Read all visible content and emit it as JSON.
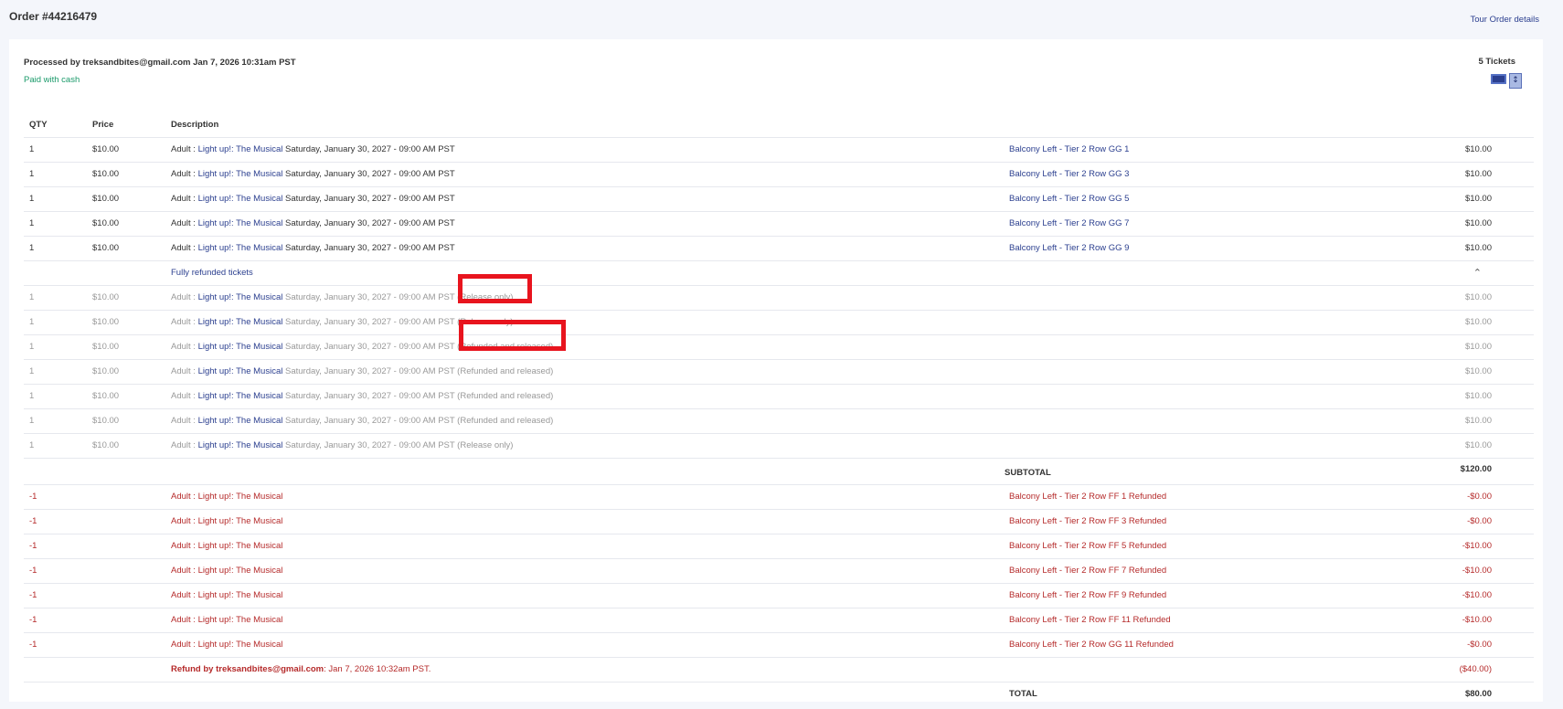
{
  "header": {
    "order_title": "Order #44216479",
    "tour_link": "Tour Order details"
  },
  "summary": {
    "processed_by": "Processed by treksandbites@gmail.com Jan 7, 2026 10:31am PST",
    "payment": "Paid with cash",
    "tickets_count": "5 Tickets",
    "icons": [
      "ticket-card-icon",
      "print-document-icon"
    ]
  },
  "table": {
    "headers": {
      "qty": "QTY",
      "price": "Price",
      "description": "Description"
    },
    "active_rows": [
      {
        "qty": "1",
        "price": "$10.00",
        "prefix": "Adult : ",
        "name": "Light up!: The Musical",
        "date": " Saturday, January 30, 2027 - 09:00 AM PST",
        "seat": "Balcony Left - Tier 2 Row GG 1",
        "amount": "$10.00"
      },
      {
        "qty": "1",
        "price": "$10.00",
        "prefix": "Adult : ",
        "name": "Light up!: The Musical",
        "date": " Saturday, January 30, 2027 - 09:00 AM PST",
        "seat": "Balcony Left - Tier 2 Row GG 3",
        "amount": "$10.00"
      },
      {
        "qty": "1",
        "price": "$10.00",
        "prefix": "Adult : ",
        "name": "Light up!: The Musical",
        "date": " Saturday, January 30, 2027 - 09:00 AM PST",
        "seat": "Balcony Left - Tier 2 Row GG 5",
        "amount": "$10.00"
      },
      {
        "qty": "1",
        "price": "$10.00",
        "prefix": "Adult : ",
        "name": "Light up!: The Musical",
        "date": " Saturday, January 30, 2027 - 09:00 AM PST",
        "seat": "Balcony Left - Tier 2 Row GG 7",
        "amount": "$10.00"
      },
      {
        "qty": "1",
        "price": "$10.00",
        "prefix": "Adult : ",
        "name": "Light up!: The Musical",
        "date": " Saturday, January 30, 2027 - 09:00 AM PST",
        "seat": "Balcony Left - Tier 2 Row GG 9",
        "amount": "$10.00"
      }
    ],
    "refunded_toggle": {
      "label": "Fully refunded tickets",
      "icon": "chevron-up-icon"
    },
    "refunded_rows": [
      {
        "qty": "1",
        "price": "$10.00",
        "prefix": "Adult : ",
        "name": "Light up!: The Musical",
        "date": " Saturday, January 30, 2027 - 09:00 AM PST ",
        "status": "(Release only)",
        "amount": "$10.00"
      },
      {
        "qty": "1",
        "price": "$10.00",
        "prefix": "Adult : ",
        "name": "Light up!: The Musical",
        "date": " Saturday, January 30, 2027 - 09:00 AM PST ",
        "status": "(Release only)",
        "amount": "$10.00"
      },
      {
        "qty": "1",
        "price": "$10.00",
        "prefix": "Adult : ",
        "name": "Light up!: The Musical",
        "date": " Saturday, January 30, 2027 - 09:00 AM PST ",
        "status": "(Refunded and released)",
        "amount": "$10.00"
      },
      {
        "qty": "1",
        "price": "$10.00",
        "prefix": "Adult : ",
        "name": "Light up!: The Musical",
        "date": " Saturday, January 30, 2027 - 09:00 AM PST ",
        "status": "(Refunded and released)",
        "amount": "$10.00"
      },
      {
        "qty": "1",
        "price": "$10.00",
        "prefix": "Adult : ",
        "name": "Light up!: The Musical",
        "date": " Saturday, January 30, 2027 - 09:00 AM PST ",
        "status": "(Refunded and released)",
        "amount": "$10.00"
      },
      {
        "qty": "1",
        "price": "$10.00",
        "prefix": "Adult : ",
        "name": "Light up!: The Musical",
        "date": " Saturday, January 30, 2027 - 09:00 AM PST ",
        "status": "(Refunded and released)",
        "amount": "$10.00"
      },
      {
        "qty": "1",
        "price": "$10.00",
        "prefix": "Adult : ",
        "name": "Light up!: The Musical",
        "date": " Saturday, January 30, 2027 - 09:00 AM PST ",
        "status": "(Release only)",
        "amount": "$10.00"
      }
    ],
    "subtotal": {
      "label": "SUBTOTAL",
      "amount": "$120.00"
    },
    "refund_rows": [
      {
        "qty": "-1",
        "desc": "Adult : Light up!: The Musical",
        "seat": "Balcony Left - Tier 2 Row FF 1 Refunded",
        "amount": "-$0.00"
      },
      {
        "qty": "-1",
        "desc": "Adult : Light up!: The Musical",
        "seat": "Balcony Left - Tier 2 Row FF 3 Refunded",
        "amount": "-$0.00"
      },
      {
        "qty": "-1",
        "desc": "Adult : Light up!: The Musical",
        "seat": "Balcony Left - Tier 2 Row FF 5 Refunded",
        "amount": "-$10.00"
      },
      {
        "qty": "-1",
        "desc": "Adult : Light up!: The Musical",
        "seat": "Balcony Left - Tier 2 Row FF 7 Refunded",
        "amount": "-$10.00"
      },
      {
        "qty": "-1",
        "desc": "Adult : Light up!: The Musical",
        "seat": "Balcony Left - Tier 2 Row FF 9 Refunded",
        "amount": "-$10.00"
      },
      {
        "qty": "-1",
        "desc": "Adult : Light up!: The Musical",
        "seat": "Balcony Left - Tier 2 Row FF 11 Refunded",
        "amount": "-$10.00"
      },
      {
        "qty": "-1",
        "desc": "Adult : Light up!: The Musical",
        "seat": "Balcony Left - Tier 2 Row GG 11 Refunded",
        "amount": "-$0.00"
      }
    ],
    "refund_note": {
      "by": "Refund by treksandbites@gmail.com",
      "when": ": Jan 7, 2026 10:32am PST.",
      "amount": "($40.00)"
    },
    "total": {
      "label": "TOTAL",
      "amount": "$80.00"
    }
  },
  "colors": {
    "link": "#2b3f8f",
    "paid": "#1a9a6a",
    "refund": "#b52a2a",
    "highlight": "#e8141e"
  }
}
